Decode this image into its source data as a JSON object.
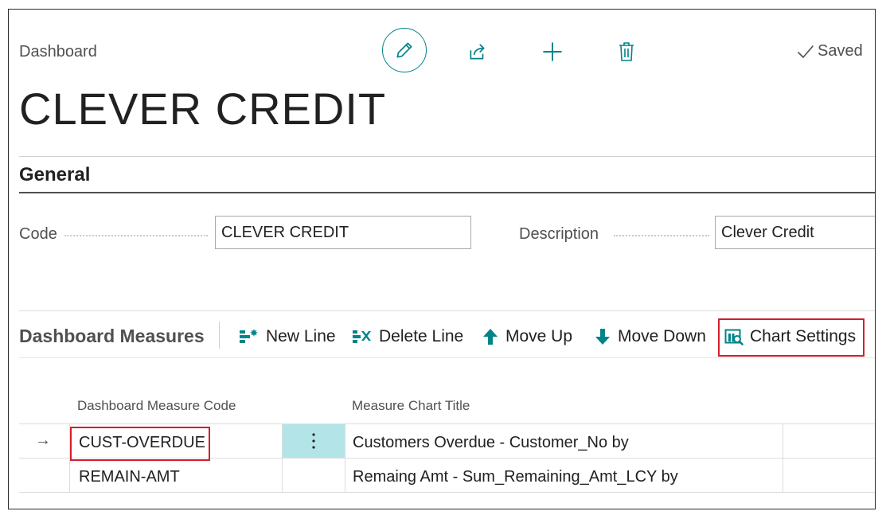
{
  "header": {
    "breadcrumb": "Dashboard",
    "saved_label": "Saved",
    "title": "CLEVER CREDIT"
  },
  "toolbar": {
    "icons": [
      "edit-pencil-icon",
      "share-icon",
      "plus-icon",
      "trash-icon",
      "checkmark-icon"
    ]
  },
  "general": {
    "section_title": "General",
    "code_label": "Code",
    "code_value": "CLEVER CREDIT",
    "description_label": "Description",
    "description_value": "Clever Credit"
  },
  "measures": {
    "title": "Dashboard Measures",
    "actions": {
      "new_line": "New Line",
      "delete_line": "Delete Line",
      "move_up": "Move Up",
      "move_down": "Move Down",
      "chart_settings": "Chart Settings"
    },
    "columns": [
      "Dashboard Measure Code",
      "Measure Chart Title"
    ],
    "rows": [
      {
        "code": "CUST-OVERDUE",
        "title": "Customers Overdue - Customer_No by"
      },
      {
        "code": "REMAIN-AMT",
        "title": "Remaing Amt - Sum_Remaining_Amt_LCY by"
      }
    ]
  },
  "colors": {
    "accent": "#008489",
    "highlight": "#d41f2a",
    "selected_cell": "#b3e5e8"
  }
}
